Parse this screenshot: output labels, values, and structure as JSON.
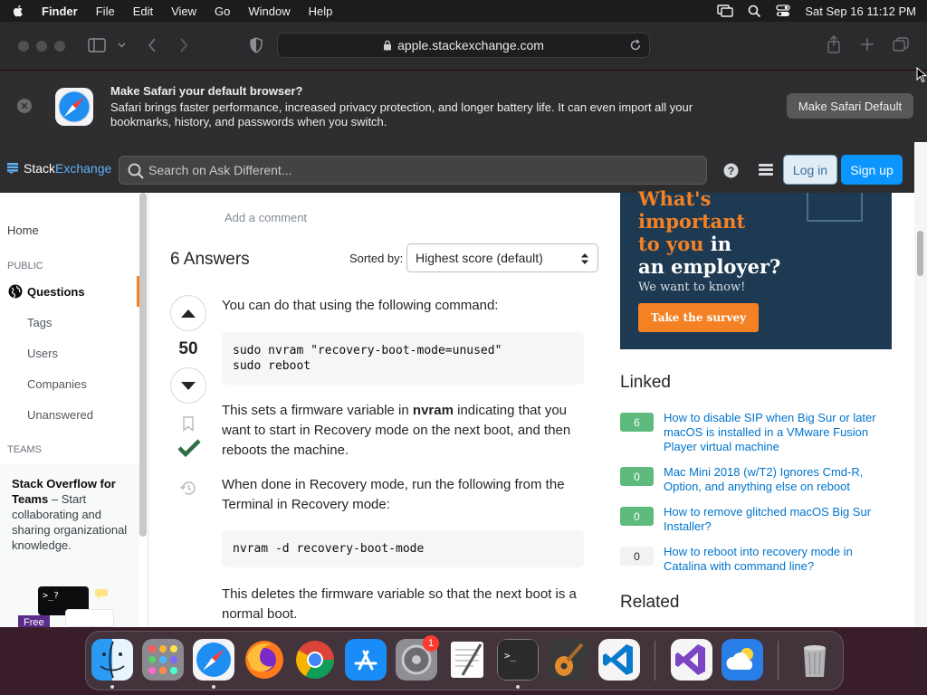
{
  "menubar": {
    "app": "Finder",
    "items": [
      "File",
      "Edit",
      "View",
      "Go",
      "Window",
      "Help"
    ],
    "datetime": "Sat Sep 16  11:12 PM"
  },
  "safari": {
    "url": "apple.stackexchange.com",
    "banner": {
      "title": "Make Safari your default browser?",
      "text": "Safari brings faster performance, increased privacy protection, and longer battery life. It can even import all your bookmarks, history, and passwords when you switch.",
      "button": "Make Safari Default"
    }
  },
  "site": {
    "logo_stack": "Stack",
    "logo_exchange": "Exchange",
    "search_placeholder": "Search on Ask Different...",
    "login": "Log in",
    "signup": "Sign up"
  },
  "leftnav": {
    "home": "Home",
    "public_header": "PUBLIC",
    "questions": "Questions",
    "tags": "Tags",
    "users": "Users",
    "companies": "Companies",
    "unanswered": "Unanswered",
    "teams_header": "TEAMS",
    "teams_title": "Stack Overflow for Teams",
    "teams_text": " – Start collaborating and sharing organizational knowledge.",
    "terminal_prompt": ">_?",
    "free": "Free"
  },
  "main": {
    "add_comment": "Add a comment",
    "answers_count": "6 Answers",
    "sorted_by": "Sorted by:",
    "sort_value": "Highest score (default)",
    "score": "50",
    "p1": "You can do that using the following command:",
    "code1": "sudo nvram \"recovery-boot-mode=unused\"\nsudo reboot",
    "p2_a": "This sets a firmware variable in ",
    "p2_b": "nvram",
    "p2_c": " indicating that you want to start in Recovery mode on the next boot, and then reboots the machine.",
    "p3": "When done in Recovery mode, run the following from the Terminal in Recovery mode:",
    "code2": "nvram -d recovery-boot-mode",
    "p4": "This deletes the firmware variable so that the next boot is a normal boot."
  },
  "ad": {
    "line1": "What's",
    "line2": "important",
    "line3a": "to you",
    "line3b": " in",
    "line4": "an employer?",
    "sub": "We want to know!",
    "button": "Take the survey"
  },
  "linked": {
    "header": "Linked",
    "items": [
      {
        "count": "6",
        "title": "How to disable SIP when Big Sur or later macOS is installed in a VMware Fusion Player virtual machine",
        "answered": true
      },
      {
        "count": "0",
        "title": "Mac Mini 2018 (w/T2) Ignores Cmd-R, Option, and anything else on reboot",
        "answered": true
      },
      {
        "count": "0",
        "title": "How to remove glitched macOS Big Sur Installer?",
        "answered": true
      },
      {
        "count": "0",
        "title": "How to reboot into recovery mode in Catalina with command line?",
        "answered": false
      }
    ]
  },
  "related": {
    "header": "Related"
  },
  "dock": {
    "apps": [
      "finder-icon",
      "launchpad-icon",
      "safari-icon",
      "firefox-icon",
      "chrome-icon",
      "app-store-icon",
      "system-preferences-icon",
      "textedit-icon",
      "terminal-icon",
      "garageband-icon",
      "vscode-icon",
      "visual-studio-icon",
      "weather-icon",
      "trash-icon"
    ],
    "notification_badge": "1"
  },
  "colors": {
    "accent_orange": "#f48225",
    "link_blue": "#0074cc",
    "signup_blue": "#0a95ff",
    "answered_green": "#5eba7d",
    "accepted_check": "#2f6f44"
  }
}
